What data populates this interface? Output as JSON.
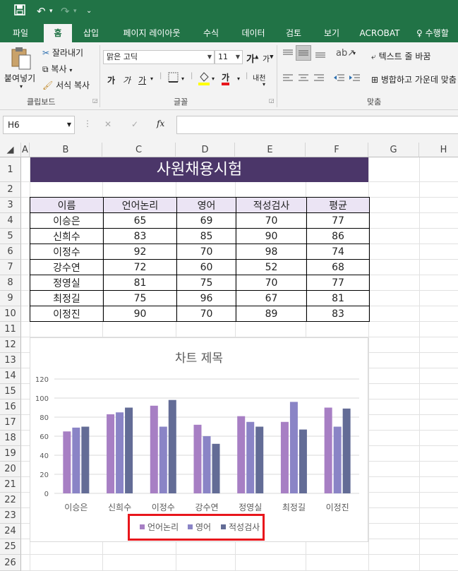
{
  "titlebar": {
    "save_icon": "save-icon",
    "undo_icon": "undo-icon",
    "redo_icon": "redo-icon",
    "customize_icon": "customize-quick-access-icon"
  },
  "tabs": [
    {
      "label": "파일"
    },
    {
      "label": "홈"
    },
    {
      "label": "삽입"
    },
    {
      "label": "페이지 레이아웃"
    },
    {
      "label": "수식"
    },
    {
      "label": "데이터"
    },
    {
      "label": "검토"
    },
    {
      "label": "보기"
    },
    {
      "label": "ACROBAT"
    },
    {
      "label": "수행할"
    }
  ],
  "ribbon": {
    "clipboard": {
      "paste": "붙여넣기",
      "cut": "잘라내기",
      "copy": "복사",
      "format_painter": "서식 복사",
      "group": "클립보드"
    },
    "font": {
      "name": "맑은 고딕",
      "size": "11",
      "grow": "가",
      "shrink": "가",
      "bold": "가",
      "italic": "가",
      "underline": "가",
      "font_color_glyph": "가",
      "phonetic": "내천",
      "group": "글꼴"
    },
    "alignment": {
      "wrap_text": "텍스트 줄 바꿈",
      "merge_center": "병합하고 가운데 맞춤",
      "group": "맞춤"
    }
  },
  "formula_bar": {
    "name_box": "H6",
    "cancel": "✕",
    "enter": "✓",
    "fx": "fx",
    "value": ""
  },
  "sheet": {
    "columns": [
      "A",
      "B",
      "C",
      "D",
      "E",
      "F",
      "G",
      "H"
    ],
    "rows": [
      "1",
      "2",
      "3",
      "4",
      "5",
      "6",
      "7",
      "8",
      "9",
      "10",
      "11",
      "12",
      "13",
      "14",
      "15",
      "16",
      "17",
      "18",
      "19",
      "20",
      "21",
      "22",
      "23",
      "24",
      "25",
      "26"
    ],
    "title": "사원채용시험",
    "table": {
      "headers": [
        "이름",
        "언어논리",
        "영어",
        "적성검사",
        "평균"
      ],
      "rows": [
        [
          "이승은",
          "65",
          "69",
          "70",
          "77"
        ],
        [
          "신희수",
          "83",
          "85",
          "90",
          "86"
        ],
        [
          "이정수",
          "92",
          "70",
          "98",
          "74"
        ],
        [
          "강수연",
          "72",
          "60",
          "52",
          "68"
        ],
        [
          "정영실",
          "81",
          "75",
          "70",
          "77"
        ],
        [
          "최정길",
          "75",
          "96",
          "67",
          "81"
        ],
        [
          "이정진",
          "90",
          "70",
          "89",
          "83"
        ]
      ]
    }
  },
  "chart_data": {
    "type": "bar",
    "title": "차트 제목",
    "categories": [
      "이승은",
      "신희수",
      "이정수",
      "강수연",
      "정영실",
      "최정길",
      "이정진"
    ],
    "series": [
      {
        "name": "언어논리",
        "values": [
          65,
          83,
          92,
          72,
          81,
          75,
          90
        ],
        "color": "#a77fc4"
      },
      {
        "name": "영어",
        "values": [
          69,
          85,
          70,
          60,
          75,
          96,
          70
        ],
        "color": "#8a84c6"
      },
      {
        "name": "적성검사",
        "values": [
          70,
          90,
          98,
          52,
          70,
          67,
          89
        ],
        "color": "#636c96"
      }
    ],
    "ylim": [
      0,
      120
    ],
    "yticks": [
      "0",
      "20",
      "40",
      "60",
      "80",
      "100",
      "120"
    ],
    "grid": true,
    "legend": "bottom"
  },
  "colors": {
    "excel_green": "#217346",
    "title_fill": "#4b3669",
    "header_fill": "#ebe4f4",
    "highlight": "#e8161c"
  }
}
